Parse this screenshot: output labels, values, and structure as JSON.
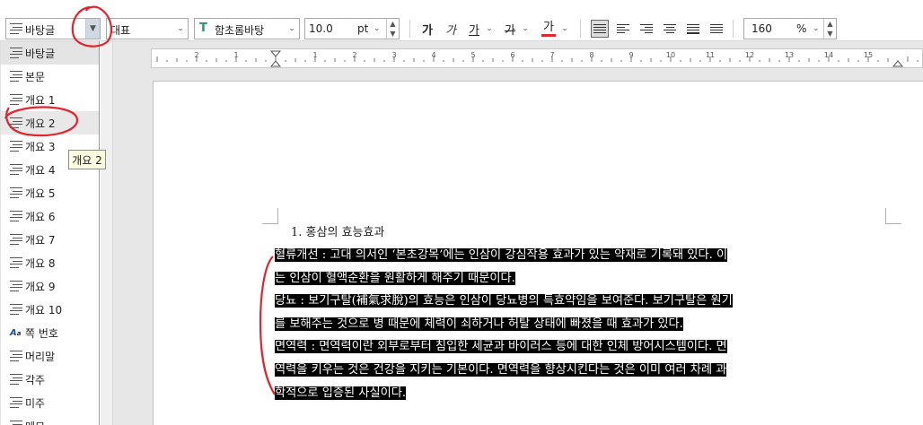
{
  "toolbar": {
    "style_value": "바탕글",
    "style_sample": "대표",
    "font_value": "함초롬바탕",
    "size_value": "10.0",
    "size_unit": "pt",
    "bold": "가",
    "italic": "가",
    "underline": "가",
    "strike": "가",
    "color": "가",
    "zoom_value": "160",
    "zoom_unit": "%"
  },
  "style_list": {
    "items": [
      {
        "label": "바탕글",
        "icon": "paragraph-style-icon"
      },
      {
        "label": "본문",
        "icon": "paragraph-style-icon"
      },
      {
        "label": "개요 1",
        "icon": "paragraph-style-icon"
      },
      {
        "label": "개요 2",
        "icon": "paragraph-style-icon"
      },
      {
        "label": "개요 3",
        "icon": "paragraph-style-icon"
      },
      {
        "label": "개요 4",
        "icon": "paragraph-style-icon"
      },
      {
        "label": "개요 5",
        "icon": "paragraph-style-icon"
      },
      {
        "label": "개요 6",
        "icon": "paragraph-style-icon"
      },
      {
        "label": "개요 7",
        "icon": "paragraph-style-icon"
      },
      {
        "label": "개요 8",
        "icon": "paragraph-style-icon"
      },
      {
        "label": "개요 9",
        "icon": "paragraph-style-icon"
      },
      {
        "label": "개요 10",
        "icon": "paragraph-style-icon"
      },
      {
        "label": "쪽 번호",
        "icon": "character-style-icon"
      },
      {
        "label": "머리말",
        "icon": "paragraph-style-icon"
      },
      {
        "label": "각주",
        "icon": "paragraph-style-icon"
      },
      {
        "label": "미주",
        "icon": "paragraph-style-icon"
      },
      {
        "label": "메모",
        "icon": "paragraph-style-icon"
      }
    ],
    "tooltip": "개요 2"
  },
  "ruler": {
    "labels": [
      "2",
      "1",
      "1",
      "2",
      "3",
      "4",
      "5",
      "6",
      "7",
      "8",
      "9",
      "10",
      "11",
      "12",
      "13",
      "14",
      "15"
    ]
  },
  "document": {
    "heading": "1. 홍삼의 효능효과",
    "lines": [
      "혈류개선 : 고대 의서인 ‘본초강목’에는 인삼이 강심작용 효과가 있는 약재로 기록돼 있다. 이",
      "는 인삼이 혈액순환을 원활하게 해주기 때문이다.",
      "당뇨 : 보기구탈(補氣求脫)의 효능은 인삼이 당뇨병의 특효약임을 보여준다. 보기구탈은 원기",
      "를 보해주는 것으로 병 때문에 체력이 쇠하거나 허탈 상태에 빠졌을 때 효과가 있다.",
      "면역력 : 면역력이란 외부로부터 침입한 세균과 바이러스 등에 대한 인체 방어시스템이다. 면",
      "역력을 키우는 것은 건강을 지키는 기본이다. 면역력을 향상시킨다는 것은 이미 여러 차례 과",
      "학적으로 입증된 사실이다."
    ]
  },
  "colors": {
    "accent_annotation": "#e0262e",
    "text_color_bar": "#e0262e",
    "selection": "#000000"
  }
}
